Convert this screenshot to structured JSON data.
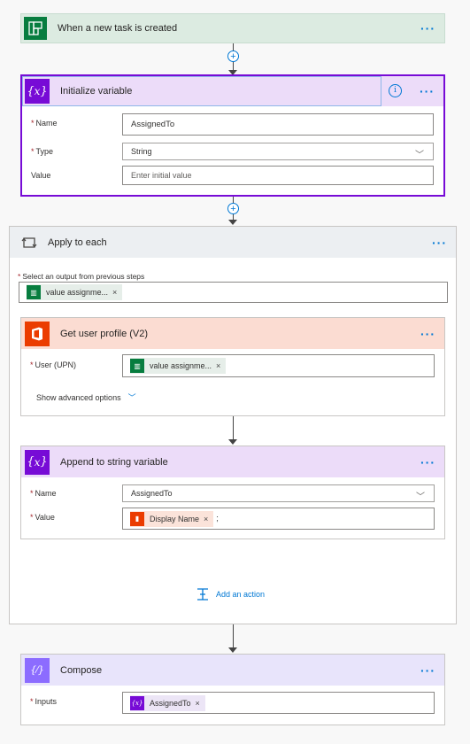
{
  "trigger": {
    "title": "When a new task is created"
  },
  "init_variable": {
    "title": "Initialize variable",
    "name_label": "Name",
    "name_value": "AssignedTo",
    "type_label": "Type",
    "type_value": "String",
    "value_label": "Value",
    "value_placeholder": "Enter initial value"
  },
  "apply_each": {
    "title": "Apply to each",
    "select_label": "Select an output from previous steps",
    "token_text": "value assignme..."
  },
  "get_profile": {
    "title": "Get user profile (V2)",
    "user_label": "User (UPN)",
    "token_text": "value assignme...",
    "advanced_label": "Show advanced options"
  },
  "append": {
    "title": "Append to string variable",
    "name_label": "Name",
    "name_value": "AssignedTo",
    "value_label": "Value",
    "token_text": "Display Name",
    "suffix": ";"
  },
  "add_action": {
    "label": "Add an action"
  },
  "compose": {
    "title": "Compose",
    "inputs_label": "Inputs",
    "token_text": "AssignedTo"
  },
  "colors": {
    "planner_green": "#077d3f",
    "variable_purple": "#770bd6",
    "office_orange": "#eb3c00",
    "compose_purple": "#8c6cff",
    "link_blue": "#0078d4"
  }
}
